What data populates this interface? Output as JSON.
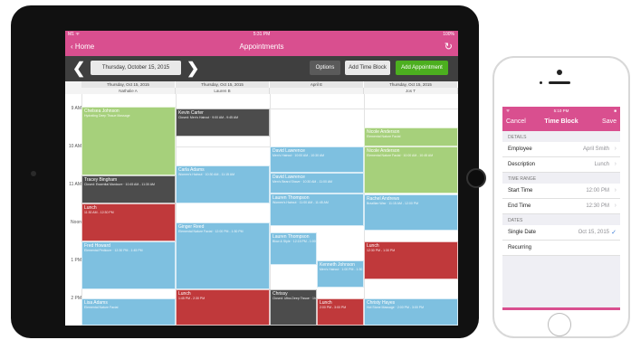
{
  "status": {
    "left": "M1 ᯤ",
    "time": "5:31 PM",
    "battery": "100%"
  },
  "nav": {
    "back": "Home",
    "title": "Appointments",
    "refresh_icon": "refresh-icon"
  },
  "toolbar": {
    "date": "Thursday, October 15, 2015",
    "options": "Options",
    "add_time_block": "Add Time Block",
    "add_appointment": "Add Appointment"
  },
  "colors": {
    "pink": "#d94f8f",
    "green_button": "#4caf1f",
    "appt_green": "#a6d07b",
    "appt_blue": "#7ec0e0",
    "appt_red": "#c0393b",
    "appt_dark": "#4c4c4c"
  },
  "columns": [
    {
      "date": "Thursday, Oct 15, 2015",
      "name": "Nathalie A"
    },
    {
      "date": "Thursday, Oct 15, 2015",
      "name": "Lauren B"
    },
    {
      "date": "April E",
      "name": ""
    },
    {
      "date": "Thursday, Oct 15, 2015",
      "name": "Jos T"
    }
  ],
  "times": [
    "9 AM",
    "10 AM",
    "11 AM",
    "Noon",
    "1 PM",
    "2 PM"
  ],
  "appointments": [
    {
      "title": "Chelsea Johnson",
      "sub": "Hydrating Deep Tissue Massage",
      "color": "green"
    },
    {
      "title": "Tracey Bingham",
      "sub": "Closed: Essential Manicure · 10:45 AM - 11:30 AM",
      "color": "dark"
    },
    {
      "title": "Lunch",
      "sub": "11:30 AM - 12:30 PM",
      "color": "red"
    },
    {
      "title": "Fred Howard",
      "sub": "Elemental Pedicure · 12:30 PM - 1:45 PM",
      "color": "blue"
    },
    {
      "title": "Lisa Adams",
      "sub": "Elemental Nature Facial",
      "color": "blue"
    },
    {
      "title": "Kevin Carter",
      "sub": "Closed: Men's Haircut · 9:00 AM - 9:45 AM",
      "color": "dark"
    },
    {
      "title": "Carla Adams",
      "sub": "Women's Haircut · 10:30 AM - 11:15 AM",
      "color": "blue"
    },
    {
      "title": "Ginger Reed",
      "sub": "Elemental Nature Facial · 12:00 PM - 1:30 PM",
      "color": "blue"
    },
    {
      "title": "Lunch",
      "sub": "1:45 PM - 2:30 PM",
      "color": "red"
    },
    {
      "title": "David Lawrence",
      "sub": "Men's Haircut · 10:00 AM - 10:30 AM",
      "color": "blue"
    },
    {
      "title": "David Lawrence",
      "sub": "Men's Beard Shave · 10:30 AM - 11:00 AM",
      "color": "blue"
    },
    {
      "title": "Lauren Thompson",
      "sub": "Women's Haircut · 11:00 AM - 11:45 AM",
      "color": "blue"
    },
    {
      "title": "Lauren Thompson",
      "sub": "Blow & Style · 12:15 PM - 1:00 PM",
      "color": "blue"
    },
    {
      "title": "Kenneth Johnson",
      "sub": "Men's Haircut · 1:00 PM - 1:30 PM",
      "color": "blue"
    },
    {
      "title": "Chrissy",
      "sub": "Closed: Ultra-Deep Tissue · 1hr+30min · 2:00 PM - 3:00 PM",
      "color": "dark"
    },
    {
      "title": "Lunch",
      "sub": "2:00 PM - 3:00 PM",
      "color": "red"
    },
    {
      "title": "Nicole Anderson",
      "sub": "Elemental Nature Facial",
      "color": "green"
    },
    {
      "title": "Nicole Anderson",
      "sub": "Elemental Nature Facial · 10:00 AM - 10:45 AM",
      "color": "green"
    },
    {
      "title": "Rachel Andrews",
      "sub": "Brazilian Wax · 11:15 AM - 12:00 PM",
      "color": "blue"
    },
    {
      "title": "Lunch",
      "sub": "12:30 PM - 1:30 PM",
      "color": "red"
    },
    {
      "title": "Christy Hayes",
      "sub": "Hot Stone Massage · 2:00 PM - 3:00 PM",
      "color": "blue"
    }
  ],
  "phone": {
    "status_left": "ᯤ",
    "status_time": "5:10 PM",
    "status_battery": "■",
    "nav_left": "Cancel",
    "nav_title": "Time Block",
    "nav_right": "Save",
    "sec_details": "DETAILS",
    "employee_label": "Employee",
    "employee_value": "April Smith",
    "description_label": "Description",
    "description_value": "Lunch",
    "sec_time": "TIME RANGE",
    "start_label": "Start Time",
    "start_value": "12:00 PM",
    "end_label": "End Time",
    "end_value": "12:30 PM",
    "sec_dates": "DATES",
    "single_label": "Single Date",
    "single_value": "Oct 15, 2015",
    "recurring_label": "Recurring"
  }
}
